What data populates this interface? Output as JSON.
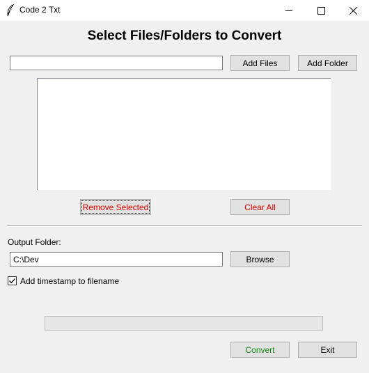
{
  "window": {
    "title": "Code 2 Txt",
    "app_icon": "feather-icon",
    "controls": [
      "minimize-icon",
      "maximize-icon",
      "close-icon"
    ]
  },
  "heading": "Select Files/Folders to Convert",
  "input": {
    "path_value": "",
    "add_files_label": "Add Files",
    "add_folder_label": "Add Folder"
  },
  "file_list": {
    "items": []
  },
  "list_actions": {
    "remove_selected_label": "Remove Selected",
    "clear_all_label": "Clear All"
  },
  "output": {
    "label": "Output Folder:",
    "folder_value": "C:\\Dev",
    "browse_label": "Browse"
  },
  "options": {
    "timestamp_label": "Add timestamp to filename",
    "timestamp_checked": true
  },
  "progress": {
    "value": 0
  },
  "actions": {
    "convert_label": "Convert",
    "exit_label": "Exit"
  },
  "colors": {
    "remove_text": "#e00000",
    "clear_text": "#e00000",
    "convert_text": "#138a13"
  }
}
